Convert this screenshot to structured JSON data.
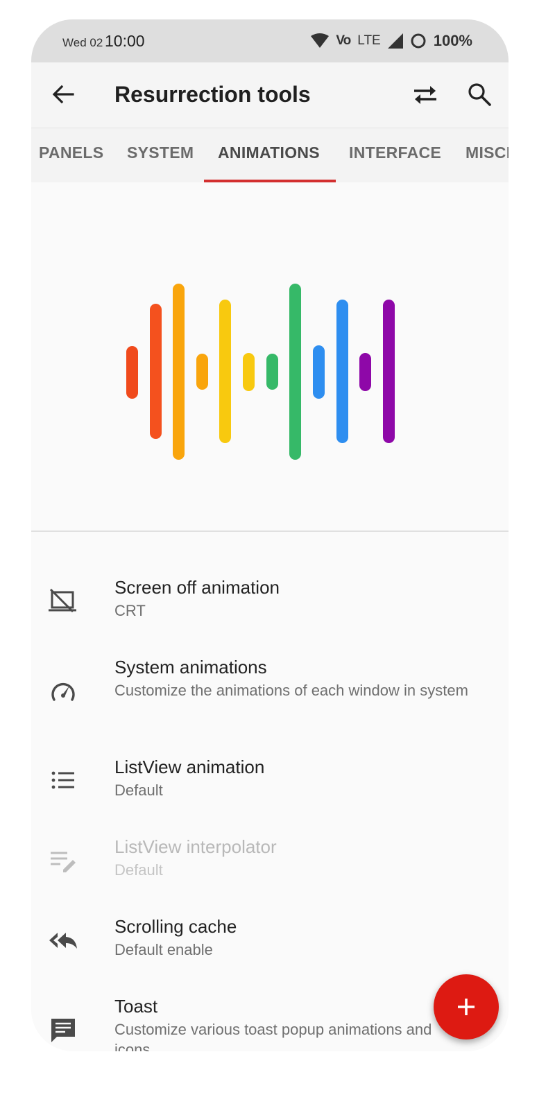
{
  "status_bar": {
    "day": "Wed 02",
    "time": "10:00",
    "volte": "Vo",
    "network": "LTE",
    "battery": "100%"
  },
  "app_bar": {
    "title": "Resurrection tools",
    "icons": [
      "back-arrow-icon",
      "swap-icon",
      "search-icon"
    ]
  },
  "tabs": [
    {
      "label": "PANELS",
      "active": false
    },
    {
      "label": "SYSTEM",
      "active": false
    },
    {
      "label": "ANIMATIONS",
      "active": true
    },
    {
      "label": "INTERFACE",
      "active": false
    },
    {
      "label": "MISCELLANEOUS",
      "active": false
    }
  ],
  "colors": {
    "accent": "#d32f2f",
    "fab": "#dd1a12",
    "hero_bars": [
      "#f04a1c",
      "#f4511e",
      "#f9a50c",
      "#f9a50c",
      "#f8c90f",
      "#f8c90f",
      "#36b968",
      "#36b968",
      "#2e8ef0",
      "#2e8ef0",
      "#8e08a8",
      "#8e08a8"
    ]
  },
  "settings": [
    {
      "title": "Screen off animation",
      "subtitle": "CRT",
      "icon": "screen-off-icon",
      "enabled": true
    },
    {
      "title": "System animations",
      "subtitle": "Customize the animations of each window in system",
      "icon": "speedometer-icon",
      "enabled": true
    },
    {
      "title": "ListView animation",
      "subtitle": "Default",
      "icon": "list-icon",
      "enabled": true
    },
    {
      "title": "ListView interpolator",
      "subtitle": "Default",
      "icon": "edit-list-icon",
      "enabled": false
    },
    {
      "title": "Scrolling cache",
      "subtitle": "Default enable",
      "icon": "reply-all-icon",
      "enabled": true
    },
    {
      "title": "Toast",
      "subtitle": "Customize various toast popup animations and icons",
      "icon": "toast-message-icon",
      "enabled": true
    }
  ],
  "fab": {
    "icon": "plus-icon"
  }
}
